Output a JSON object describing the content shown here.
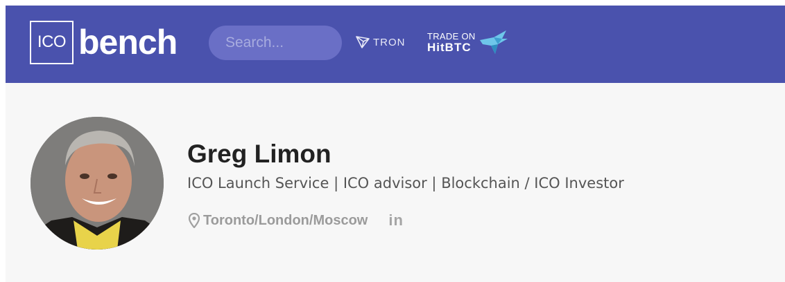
{
  "header": {
    "logo": {
      "box_text": "ICO",
      "word": "bench"
    },
    "search": {
      "placeholder": "Search..."
    },
    "sponsors": {
      "tron": "TRON",
      "hitbtc_top": "TRADE ON",
      "hitbtc_bottom": "HitBTC"
    }
  },
  "profile": {
    "name": "Greg Limon",
    "title": "ICO Launch Service | ICO advisor | Blockchain / ICO Investor",
    "location": "Toronto/London/Moscow",
    "social": {
      "linkedin": "in"
    }
  },
  "colors": {
    "navbar": "#4a52ad",
    "page_bg": "#f7f7f7",
    "name": "#222222",
    "muted": "#9b9b9b"
  },
  "icons": [
    "location-pin-icon",
    "linkedin-icon",
    "tron-icon",
    "hitbtc-bird-icon"
  ]
}
